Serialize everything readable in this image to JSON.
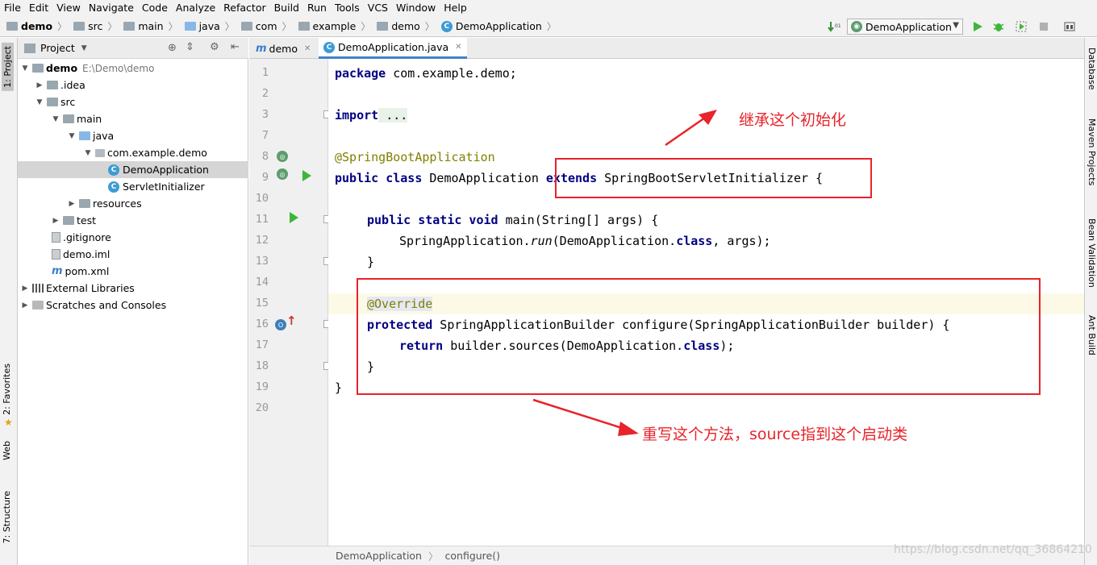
{
  "menu": [
    "File",
    "Edit",
    "View",
    "Navigate",
    "Code",
    "Analyze",
    "Refactor",
    "Build",
    "Run",
    "Tools",
    "VCS",
    "Window",
    "Help"
  ],
  "breadcrumb": [
    "demo",
    "src",
    "main",
    "java",
    "com",
    "example",
    "demo",
    "DemoApplication"
  ],
  "run_config": "DemoApplication",
  "left_tools": {
    "project": "1: Project",
    "favorites": "2: Favorites",
    "web": "Web",
    "structure": "7: Structure"
  },
  "right_tools": {
    "database": "Database",
    "maven": "Maven Projects",
    "bean": "Bean Validation",
    "ant": "Ant Build"
  },
  "project_panel": {
    "title": "Project"
  },
  "tree": [
    {
      "label": "demo",
      "extra": "E:\\Demo\\demo"
    },
    {
      "label": ".idea"
    },
    {
      "label": "src"
    },
    {
      "label": "main"
    },
    {
      "label": "java"
    },
    {
      "label": "com.example.demo"
    },
    {
      "label": "DemoApplication"
    },
    {
      "label": "ServletInitializer"
    },
    {
      "label": "resources"
    },
    {
      "label": "test"
    },
    {
      "label": ".gitignore"
    },
    {
      "label": "demo.iml"
    },
    {
      "label": "pom.xml"
    },
    {
      "label": "External Libraries"
    },
    {
      "label": "Scratches and Consoles"
    }
  ],
  "tabs": [
    "demo",
    "DemoApplication.java"
  ],
  "line_numbers": [
    "1",
    "2",
    "3",
    "7",
    "8",
    "9",
    "10",
    "11",
    "12",
    "13",
    "14",
    "15",
    "16",
    "17",
    "18",
    "19",
    "20"
  ],
  "code": {
    "l1_kw": "package",
    "l1_rest": " com.example.demo;",
    "l3_kw": "import",
    "l3_rest": " ...",
    "l8": "@SpringBootApplication",
    "l9_kw1": "public class",
    "l9_name": " DemoApplication ",
    "l9_kw2": "extends",
    "l9_rest": " SpringBootServletInitializer {",
    "l11_kw": "public static void",
    "l11_rest": " main(String[] args) {",
    "l12_a": "SpringApplication.",
    "l12_run": "run",
    "l12_b": "(DemoApplication.",
    "l12_kw": "class",
    "l12_c": ", args);",
    "l13": "}",
    "l15": "@Override",
    "l16_kw": "protected",
    "l16_rest": " SpringApplicationBuilder configure(SpringApplicationBuilder builder) {",
    "l17_kw": "return",
    "l17_a": " builder.sources(DemoApplication.",
    "l17_kw2": "class",
    "l17_b": ");",
    "l18": "}",
    "l19": "}"
  },
  "status_path": [
    "DemoApplication",
    "configure()"
  ],
  "annotations": {
    "top": "继承这个初始化",
    "bottom": "重写这个方法，source指到这个启动类"
  },
  "watermark": "https://blog.csdn.net/qq_36864210",
  "colors": {
    "accent": "#e8232a",
    "keyword": "#000080",
    "annotation": "#808000",
    "run": "#3fb53a"
  }
}
